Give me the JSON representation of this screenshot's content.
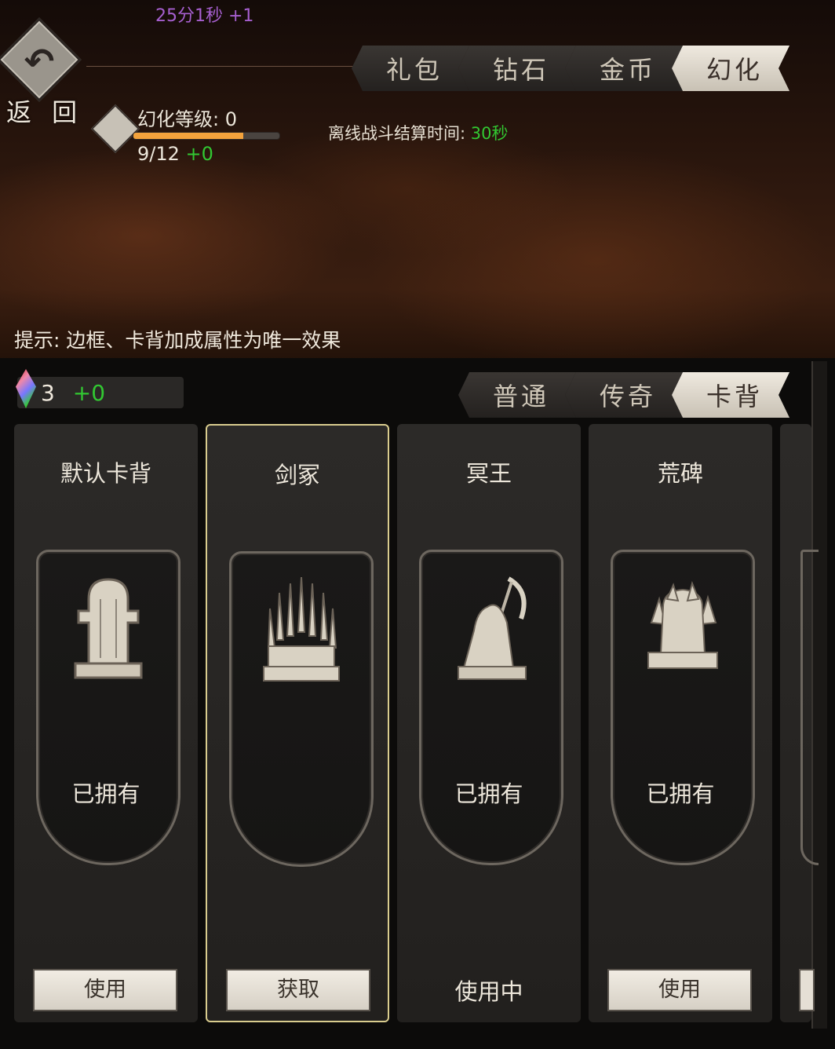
{
  "header": {
    "timer_text": "25分1秒 +1",
    "back_label": "返 回",
    "tabs": [
      {
        "label": "礼包",
        "active": false
      },
      {
        "label": "钻石",
        "active": false
      },
      {
        "label": "金币",
        "active": false
      },
      {
        "label": "幻化",
        "active": true
      }
    ]
  },
  "level": {
    "title": "幻化等级: 0",
    "progress_current": "9/12",
    "progress_bonus": "+0",
    "progress_fraction": 0.75
  },
  "offline": {
    "label": "离线战斗结算时间:",
    "value": "30秒"
  },
  "hint": "提示: 边框、卡背加成属性为唯一效果",
  "gems": {
    "count": "3",
    "bonus": "+0"
  },
  "subtabs": [
    {
      "label": "普通",
      "active": false
    },
    {
      "label": "传奇",
      "active": false
    },
    {
      "label": "卡背",
      "active": true
    }
  ],
  "cards": [
    {
      "name": "默认卡背",
      "status": "已拥有",
      "action": "使用",
      "icon": "tombstone-icon"
    },
    {
      "name": "剑冢",
      "status": "",
      "action": "获取",
      "icon": "sword-throne-icon"
    },
    {
      "name": "冥王",
      "status": "已拥有",
      "action": "使用中",
      "icon": "reaper-icon"
    },
    {
      "name": "荒碑",
      "status": "已拥有",
      "action": "使用",
      "icon": "crystal-grave-icon"
    }
  ],
  "colors": {
    "accent_green": "#32c832",
    "timer_purple": "#a65fcf",
    "progress_orange": "#f2a23c",
    "selected_border": "#d9cc8e"
  }
}
